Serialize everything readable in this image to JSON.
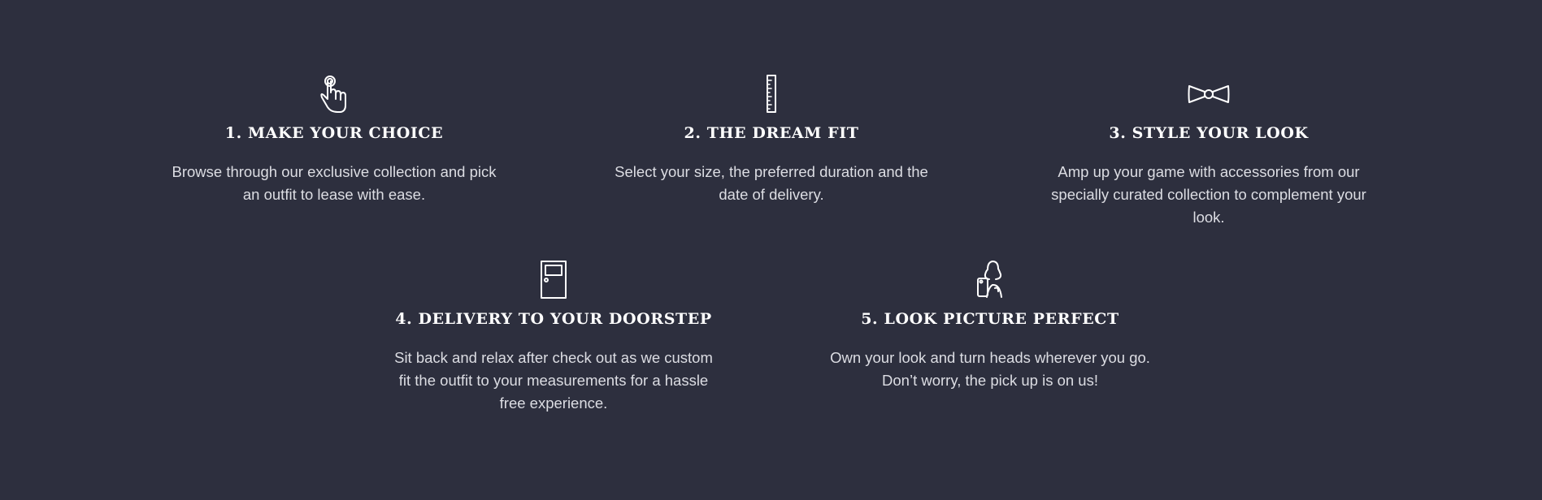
{
  "steps": [
    {
      "icon": "tap-hand-icon",
      "title": "1. MAKE YOUR CHOICE",
      "description": "Browse through our exclusive collection and pick an outfit to lease with ease."
    },
    {
      "icon": "ruler-icon",
      "title": "2. THE DREAM FIT",
      "description": "Select your size, the preferred duration and the date of delivery."
    },
    {
      "icon": "bow-tie-icon",
      "title": "3. STYLE YOUR LOOK",
      "description": "Amp up your game with accessories from our specially curated collection to complement your look."
    },
    {
      "icon": "door-icon",
      "title": "4. DELIVERY TO YOUR DOORSTEP",
      "description": "Sit back and relax after check out as we custom fit the outfit to your measurements for a hassle free experience."
    },
    {
      "icon": "selfie-icon",
      "title": "5. LOOK PICTURE PERFECT",
      "description": "Own your look and turn heads wherever you go. Don’t worry, the pick up is on us!"
    }
  ],
  "colors": {
    "background": "#2d2f3e",
    "title": "#ffffff",
    "text": "#dcdde3"
  }
}
